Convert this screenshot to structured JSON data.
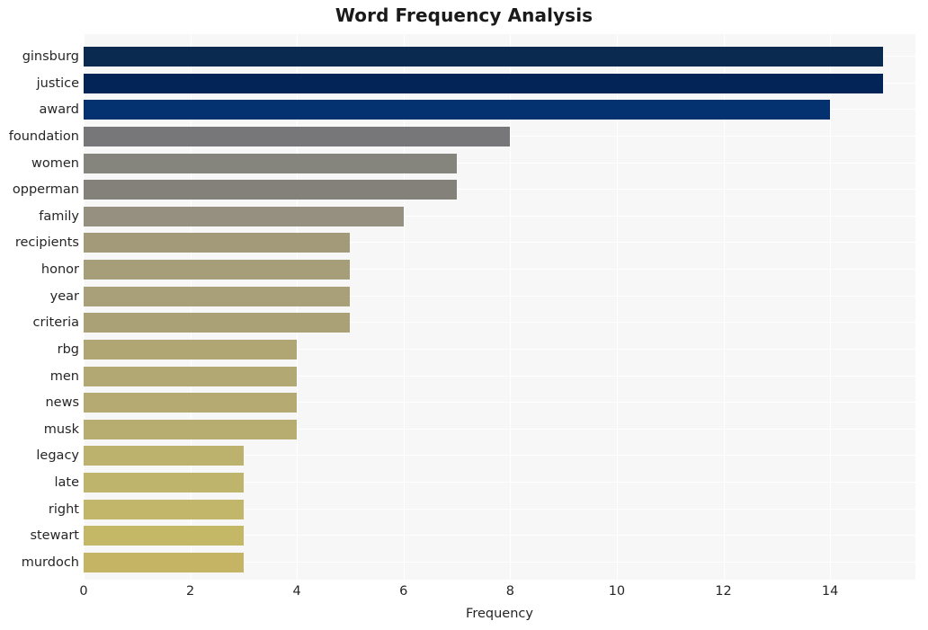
{
  "chart_data": {
    "type": "bar",
    "orientation": "horizontal",
    "title": "Word Frequency Analysis",
    "xlabel": "Frequency",
    "ylabel": "",
    "categories": [
      "ginsburg",
      "justice",
      "award",
      "foundation",
      "women",
      "opperman",
      "family",
      "recipients",
      "honor",
      "year",
      "criteria",
      "rbg",
      "men",
      "news",
      "musk",
      "legacy",
      "late",
      "right",
      "stewart",
      "murdoch"
    ],
    "values": [
      15,
      15,
      14,
      8,
      7,
      7,
      6,
      5,
      5,
      5,
      5,
      4,
      4,
      4,
      4,
      3,
      3,
      3,
      3,
      3
    ],
    "bar_colors": [
      "#0a2a50",
      "#032456",
      "#043270",
      "#77777a",
      "#85847d",
      "#838179",
      "#959080",
      "#a39a7a",
      "#a69d79",
      "#a99f78",
      "#aba177",
      "#b0a674",
      "#b2a873",
      "#b5ab72",
      "#b7ad70",
      "#bcb16d",
      "#bfb46b",
      "#c1b669",
      "#c4b867",
      "#c6b465"
    ],
    "xticks": [
      0,
      2,
      4,
      6,
      8,
      10,
      12,
      14
    ],
    "xlim": [
      0,
      15.6
    ],
    "ylim_count": 20,
    "grid": true,
    "grid_color": "#ffffff",
    "plot_background": "#f7f7f7",
    "figure_background": "#ffffff",
    "legend": null
  }
}
